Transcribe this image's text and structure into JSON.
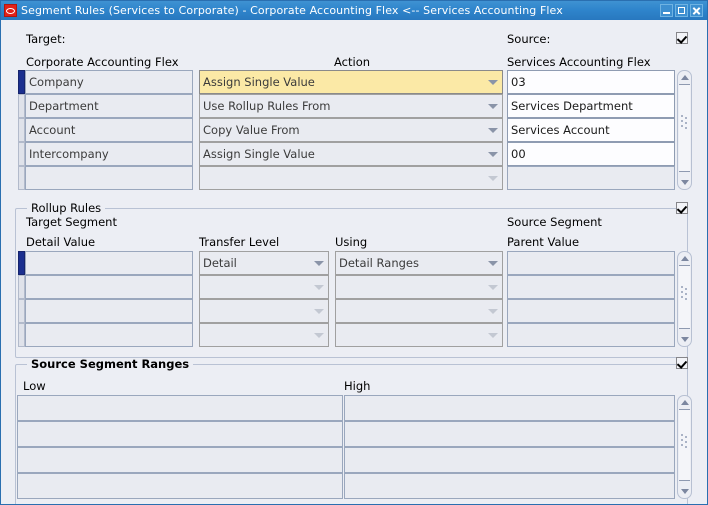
{
  "window": {
    "title": "Segment Rules (Services to Corporate) - Corporate Accounting Flex <-- Services Accounting Flex",
    "app_icon": "oracle-logo-icon",
    "buttons": {
      "minimize": "minimize-icon",
      "maximize": "maximize-icon",
      "close": "close-icon"
    }
  },
  "segment_rules": {
    "target_label": "Target:",
    "source_label": "Source:",
    "columns": {
      "target": "Corporate Accounting Flex",
      "action": "Action",
      "source": "Services Accounting Flex"
    },
    "rows": [
      {
        "target": "Company",
        "action": "Assign Single Value",
        "source": "03"
      },
      {
        "target": "Department",
        "action": "Use Rollup Rules From",
        "source": "Services Department"
      },
      {
        "target": "Account",
        "action": "Copy Value From",
        "source": "Services Account"
      },
      {
        "target": "Intercompany",
        "action": "Assign Single Value",
        "source": "00"
      },
      {
        "target": "",
        "action": "",
        "source": ""
      }
    ]
  },
  "rollup_rules": {
    "group_title": "Rollup Rules",
    "target_segment_label": "Target Segment",
    "source_segment_label": "Source Segment",
    "columns": {
      "detail_value": "Detail Value",
      "transfer_level": "Transfer Level",
      "using": "Using",
      "parent_value": "Parent Value"
    },
    "rows": [
      {
        "detail_value": "",
        "transfer_level": "Detail",
        "using": "Detail Ranges",
        "parent_value": ""
      },
      {
        "detail_value": "",
        "transfer_level": "",
        "using": "",
        "parent_value": ""
      },
      {
        "detail_value": "",
        "transfer_level": "",
        "using": "",
        "parent_value": ""
      },
      {
        "detail_value": "",
        "transfer_level": "",
        "using": "",
        "parent_value": ""
      }
    ]
  },
  "source_segment_ranges": {
    "group_title": "Source Segment Ranges",
    "columns": {
      "low": "Low",
      "high": "High"
    },
    "rows": [
      {
        "low": "",
        "high": ""
      },
      {
        "low": "",
        "high": ""
      },
      {
        "low": "",
        "high": ""
      },
      {
        "low": "",
        "high": ""
      }
    ]
  },
  "colors": {
    "titlebar": "#2f85cc",
    "focused_field": "#fbe9a6",
    "selected_row_marker": "#1b2f8f",
    "app_icon": "#e32119",
    "panel": "#eceef4"
  }
}
